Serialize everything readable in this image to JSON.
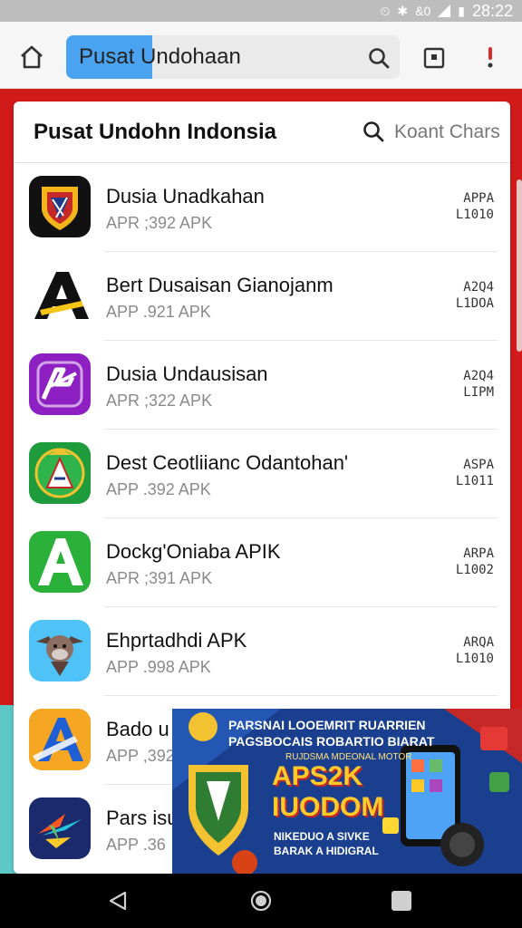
{
  "status_bar": {
    "time": "28:22",
    "extra": "&0"
  },
  "browser": {
    "url_text": "Pusat Undohaan"
  },
  "card": {
    "title": "Pusat Undohn Indonsia",
    "search_text": "Koant Chars"
  },
  "apps": [
    {
      "name": "Dusia Unadkahan",
      "sub": "APR ;392  APK",
      "badge1": "APPA",
      "badge2": "L1010",
      "icon": "shield-logo-icon"
    },
    {
      "name": "Bert Dusaisan Gianojanm",
      "sub": "APP .921  APK",
      "badge1": "A2Q4",
      "badge2": "L1DOA",
      "icon": "letter-a-black-icon"
    },
    {
      "name": "Dusia Undausisan",
      "sub": "APR ;322  APK",
      "badge1": "A2Q4",
      "badge2": "LIPM",
      "icon": "purple-ap-icon"
    },
    {
      "name": "Dest Ceotliianc Odantohan'",
      "sub": "APP .392  APK",
      "badge1": "ASPA",
      "badge2": "L1011",
      "icon": "green-emblem-icon"
    },
    {
      "name": "Dockg'Oniaba APIK",
      "sub": "APR ;391  APK",
      "badge1": "ARPA",
      "badge2": "L1002",
      "icon": "letter-a-green-icon"
    },
    {
      "name": "Ehprtadhdi APK",
      "sub": "APP .998  APK",
      "badge1": "ARQA",
      "badge2": "L1010",
      "icon": "monkey-icon"
    },
    {
      "name": "Bado u",
      "sub": "APP ,392",
      "icon": "letter-a-orange-icon"
    },
    {
      "name": "Pars isu",
      "sub": "APP .36",
      "icon": "colorful-arrow-icon"
    }
  ],
  "ad": {
    "line1": "PARSNAI LOOEMRIT RUARRIEN",
    "line2": "PAGSBOCAIS ROBARTIO BIARAT",
    "line3": "RUJDSMA MDEONAL MOTOR",
    "big1": "APS2K",
    "big2": "IUODOM",
    "line4": "NIKEDUO A SIVKE",
    "line5": "BARAK A HIDIGRAL"
  },
  "colors": {
    "background": "#d11a1a",
    "accent": "#4aa3f0"
  }
}
